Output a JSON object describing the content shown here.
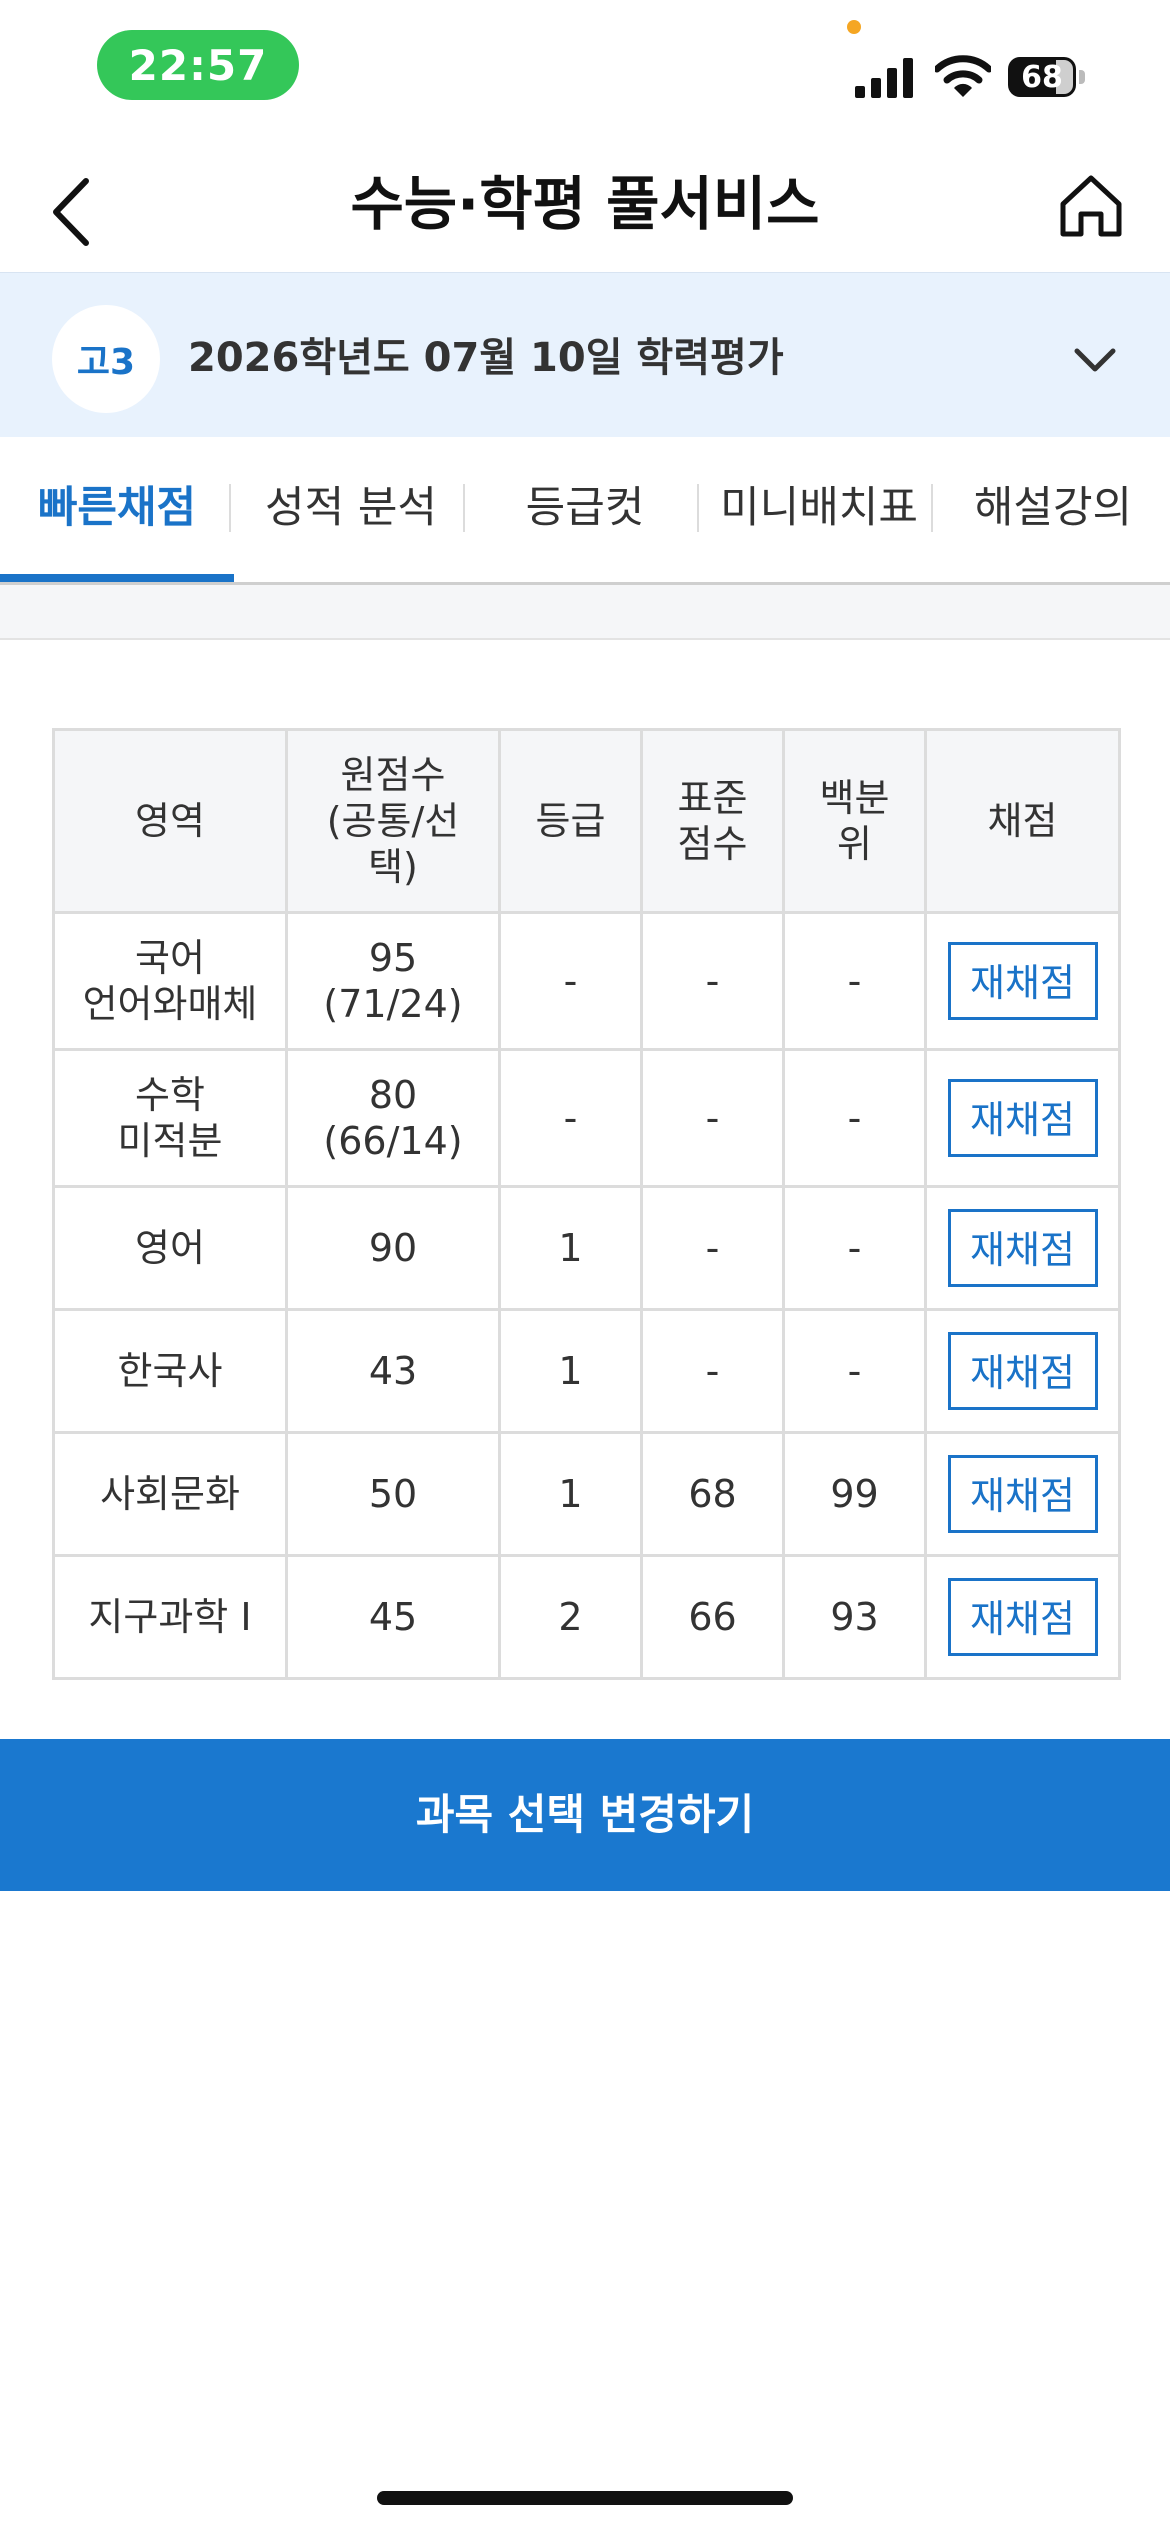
{
  "status_bar": {
    "time": "22:57",
    "battery": "68"
  },
  "header": {
    "title": "수능·학평 풀서비스"
  },
  "exam": {
    "grade": "고3",
    "title": "2026학년도 07월 10일 학력평가"
  },
  "tabs": [
    {
      "label": "빠른채점",
      "active": true
    },
    {
      "label": "성적 분석",
      "active": false
    },
    {
      "label": "등급컷",
      "active": false
    },
    {
      "label": "미니배치표",
      "active": false
    },
    {
      "label": "해설강의",
      "active": false
    }
  ],
  "table": {
    "headers": {
      "subject": "영역",
      "raw": "원점수",
      "raw_sub_1": "(공통/선",
      "raw_sub_2": "택)",
      "grade": "등급",
      "standard_1": "표준",
      "standard_2": "점수",
      "percentile_1": "백분",
      "percentile_2": "위",
      "scoring": "채점"
    },
    "rows": [
      {
        "subject": "국어",
        "subject_sub": "언어와매체",
        "raw": "95",
        "raw_sub": "(71/24)",
        "grade": "-",
        "standard": "-",
        "percentile": "-",
        "action": "재채점"
      },
      {
        "subject": "수학",
        "subject_sub": "미적분",
        "raw": "80",
        "raw_sub": "(66/14)",
        "grade": "-",
        "standard": "-",
        "percentile": "-",
        "action": "재채점"
      },
      {
        "subject": "영어",
        "raw": "90",
        "grade": "1",
        "standard": "-",
        "percentile": "-",
        "action": "재채점"
      },
      {
        "subject": "한국사",
        "raw": "43",
        "grade": "1",
        "standard": "-",
        "percentile": "-",
        "action": "재채점"
      },
      {
        "subject": "사회문화",
        "raw": "50",
        "grade": "1",
        "standard": "68",
        "percentile": "99",
        "action": "재채점"
      },
      {
        "subject": "지구과학 I",
        "raw": "45",
        "grade": "2",
        "standard": "66",
        "percentile": "93",
        "action": "재채점"
      }
    ]
  },
  "footer": {
    "change_subject_label": "과목 선택 변경하기"
  },
  "colors": {
    "accent": "#1a73c8",
    "button_bg": "#1a78cf",
    "status_pill": "#34c759",
    "selector_bg": "#e8f2fd"
  },
  "icons": {
    "back": "chevron-left-icon",
    "home": "home-icon",
    "dropdown": "chevron-down-icon"
  }
}
